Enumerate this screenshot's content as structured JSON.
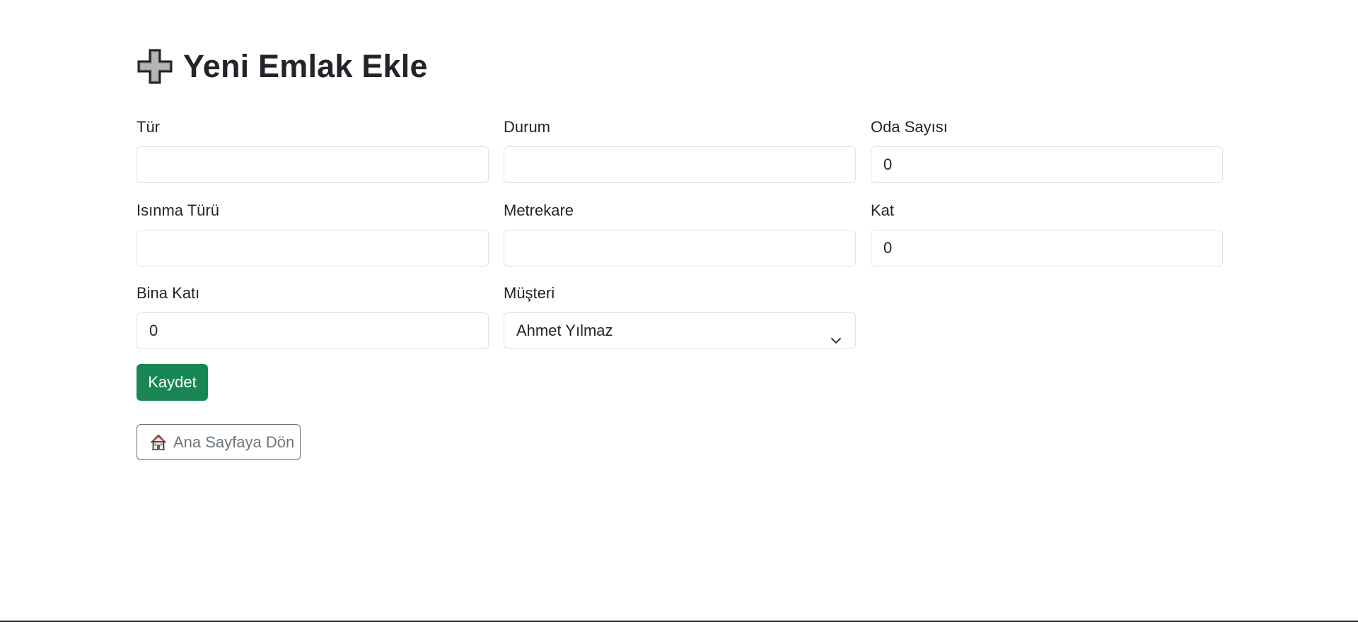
{
  "header": {
    "title": "Yeni Emlak Ekle",
    "icon": "plus-icon"
  },
  "form": {
    "fields": [
      {
        "label": "Tür",
        "value": ""
      },
      {
        "label": "Durum",
        "value": ""
      },
      {
        "label": "Oda Sayısı",
        "value": "0"
      },
      {
        "label": "Isınma Türü",
        "value": ""
      },
      {
        "label": "Metrekare",
        "value": ""
      },
      {
        "label": "Kat",
        "value": "0"
      },
      {
        "label": "Bina Katı",
        "value": "0"
      }
    ],
    "customer": {
      "label": "Müşteri",
      "selected": "Ahmet Yılmaz"
    },
    "save_label": "Kaydet"
  },
  "nav": {
    "home_label": "Ana Sayfaya Dön",
    "home_icon": "house-icon"
  },
  "colors": {
    "success": "#198754",
    "secondary": "#6c757d",
    "border": "#dee2e6",
    "text": "#212529"
  }
}
